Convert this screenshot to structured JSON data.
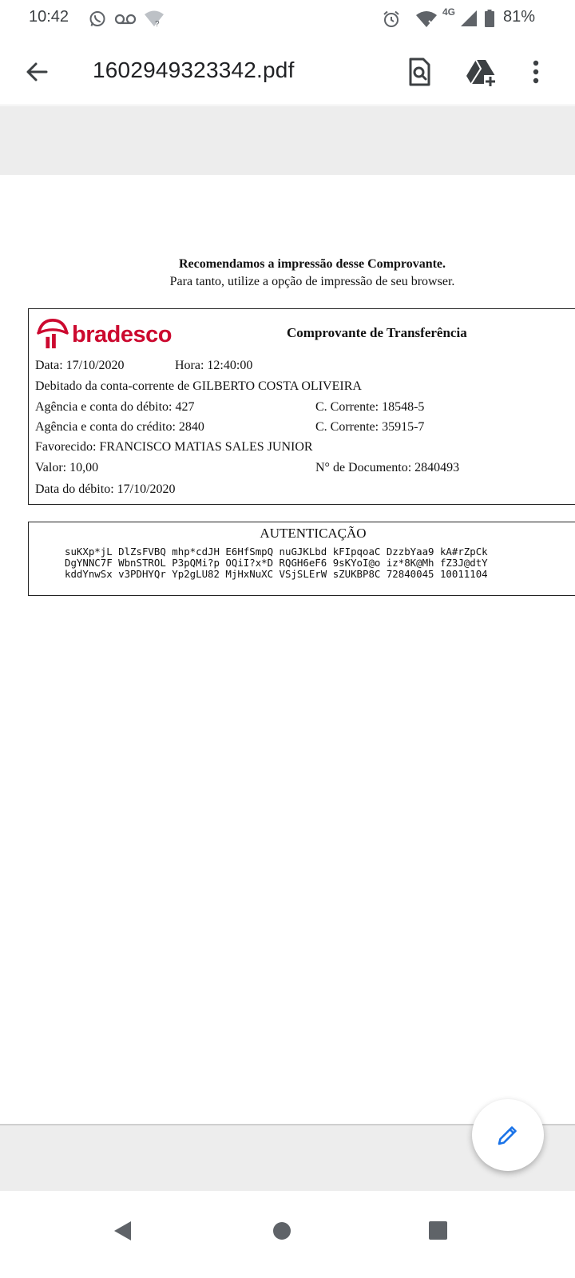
{
  "status_bar": {
    "time": "10:42",
    "icons": [
      "whatsapp-icon",
      "voicemail-icon",
      "wifi-unknown-icon",
      "alarm-icon",
      "wifi-icon",
      "signal-4g-icon",
      "battery-icon"
    ],
    "network": "4G",
    "battery": "81%"
  },
  "app_bar": {
    "title": "1602949323342.pdf",
    "actions": [
      "search-document-icon",
      "drive-add-icon",
      "more-vert-icon"
    ]
  },
  "document": {
    "recommend_title": "Recomendamos a impressão desse Comprovante.",
    "recommend_subtitle": "Para tanto, utilize a opção de impressão de seu browser.",
    "receipt": {
      "bank_name": "bradesco",
      "title": "Comprovante de Transferência",
      "data": "Data: 17/10/2020",
      "hora": "Hora: 12:40:00",
      "debitado": "Debitado da conta-corrente de GILBERTO COSTA OLIVEIRA",
      "agencia_debito": "Agência e conta do débito: 427",
      "cc_debito": "C. Corrente: 18548-5",
      "agencia_credito": "Agência e conta do crédito: 2840",
      "cc_credito": "C. Corrente: 35915-7",
      "favorecido": "Favorecido: FRANCISCO MATIAS SALES JUNIOR",
      "valor": "Valor: 10,00",
      "documento": "N° de Documento: 2840493",
      "data_debito": "Data do débito: 17/10/2020"
    },
    "auth": {
      "title": "AUTENTICAÇÃO",
      "line1": "suKXp*jL DlZsFVBQ mhp*cdJH E6HfSmpQ nuGJKLbd kFIpqoaC DzzbYaa9 kA#rZpCk",
      "line2": "DgYNNC7F WbnSTROL P3pQMi?p OQiI?x*D RQGH6eF6 9sKYoI@o iz*8K@Mh fZ3J@dtY",
      "line3": "kddYnwSx v3PDHYQr Yp2gLU82 MjHxNuXC VSjSLErW sZUKBP8C 72840045 10011104"
    }
  },
  "fab": {
    "icon": "edit-pencil-icon"
  },
  "nav_bar": {
    "buttons": [
      "back-triangle-icon",
      "home-circle-icon",
      "recents-square-icon"
    ]
  },
  "colors": {
    "bradesco_red": "#cc092f",
    "fab_pencil": "#1a73e8",
    "grey_band": "#ededed"
  }
}
